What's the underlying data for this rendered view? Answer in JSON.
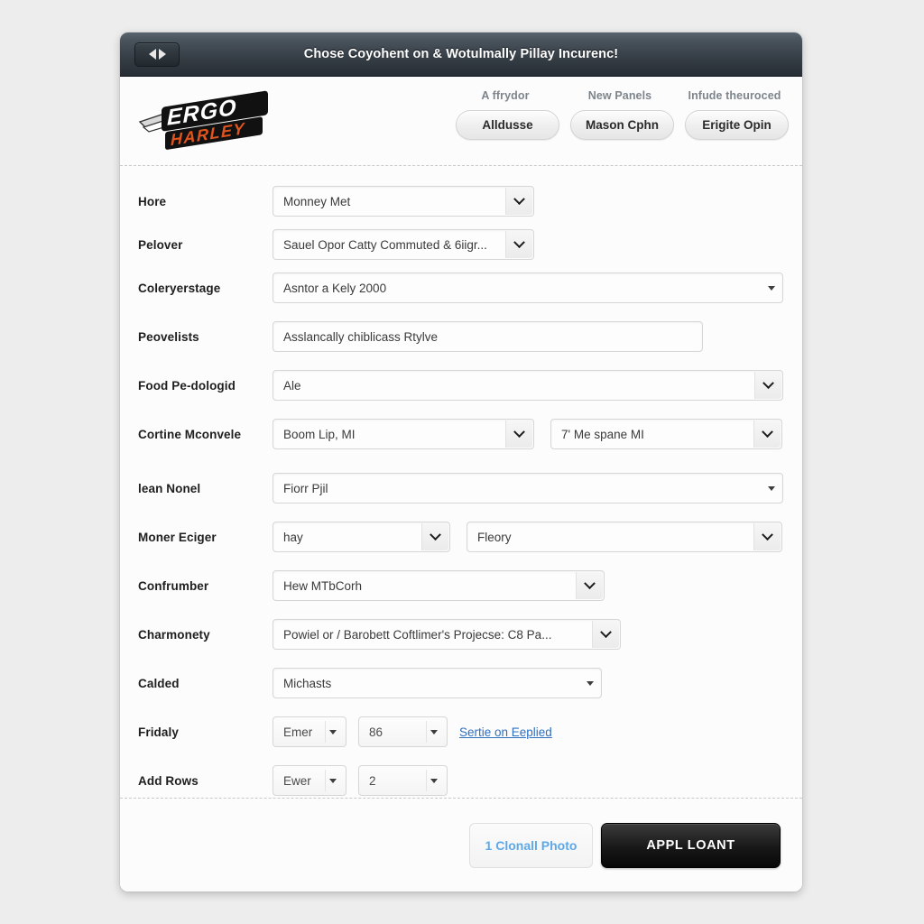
{
  "window": {
    "title": "Chose Coyohent on & Wotulmally Pillay Incurenc!",
    "back_icon": "arrow-left-icon",
    "forward_icon": "arrow-right-icon"
  },
  "brand": {
    "line1": "ERGO",
    "line2": "HARLEY",
    "line1_color": "#111111",
    "line2_color": "#e0551f"
  },
  "header_nav": [
    {
      "caption": "A ffrydor",
      "button": "Alldusse"
    },
    {
      "caption": "New Panels",
      "button": "Mason Cphn"
    },
    {
      "caption": "Infude theuroced",
      "button": "Erigite Opin"
    }
  ],
  "form": {
    "rows": [
      {
        "label": "Hore",
        "fields": [
          {
            "value": "Monney Met",
            "control": "chevron"
          }
        ]
      },
      {
        "label": "Pelover",
        "fields": [
          {
            "value": "Sauel Opor Catty Commuted & 6iigr...",
            "control": "chevron"
          }
        ]
      },
      {
        "label": "Coleryerstage",
        "fields": [
          {
            "value": "Asntor a Kely 2000",
            "control": "triangle"
          }
        ]
      },
      {
        "label": "Peovelists",
        "fields": [
          {
            "value": "Asslancally chiblicass Rtylve",
            "control": "none"
          }
        ]
      },
      {
        "label": "Food Pe-dologid",
        "fields": [
          {
            "value": "Ale",
            "control": "chevron"
          }
        ]
      },
      {
        "label": "Cortine Mconvele",
        "fields": [
          {
            "value": "Boom Lip, MI",
            "control": "chevron"
          },
          {
            "value": "7' Me spane MI",
            "control": "chevron"
          }
        ]
      },
      {
        "label": "lean Nonel",
        "fields": [
          {
            "value": "Fiorr Pjil",
            "control": "triangle"
          }
        ]
      },
      {
        "label": "Moner Eciger",
        "fields": [
          {
            "value": "hay",
            "control": "chevron"
          },
          {
            "value": "Fleory",
            "control": "chevron"
          }
        ]
      },
      {
        "label": "Confrumber",
        "fields": [
          {
            "value": "Hew MTbCorh",
            "control": "chevron"
          }
        ]
      },
      {
        "label": "Charmonety",
        "fields": [
          {
            "value": "Powiel or / Barobett Coftlimer's Projecse:  C8 Pa...",
            "control": "chevron"
          }
        ]
      },
      {
        "label": "Calded",
        "fields": [
          {
            "value": "Michasts",
            "control": "triangle"
          }
        ]
      }
    ],
    "friday_row": {
      "label": "Fridaly",
      "select_a": "Emer",
      "select_b": "86",
      "link": "Sertie on Eeplied"
    },
    "add_rows_row": {
      "label": "Add Rows",
      "select_a": "Ewer",
      "select_b": "2"
    }
  },
  "footer": {
    "secondary_button": "1 Clonall Photo",
    "primary_button": "APPL LOANT",
    "secondary_color": "#5ea8e8",
    "primary_bg": "#111111"
  }
}
